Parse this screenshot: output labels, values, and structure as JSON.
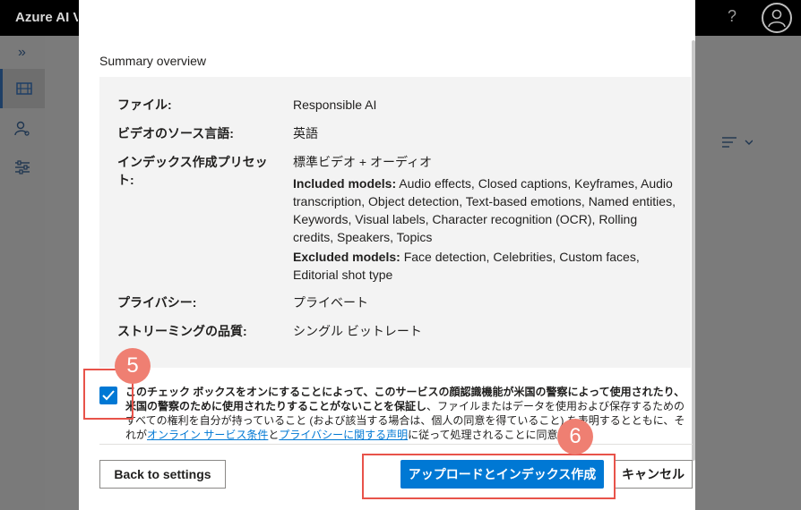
{
  "app": {
    "title": "Azure AI Video Indexer",
    "help_glyph": "?",
    "expand_glyph": "»",
    "sidebar_icons": [
      "media-icon",
      "people-icon",
      "settings-sliders-icon"
    ]
  },
  "dialog": {
    "summary_title": "Summary overview",
    "rows": {
      "file_label": "ファイル:",
      "file_value": "Responsible AI",
      "lang_label": "ビデオのソース言語:",
      "lang_value": "英語",
      "preset_label_1": "インデックス作成プリセッ",
      "preset_label_2": "ト:",
      "preset_value": "標準ビデオ + オーディオ",
      "included_label": "Included models:",
      "included_value": " Audio effects, Closed captions, Keyframes, Audio transcription, Object detection, Text-based emotions, Named entities, Keywords, Visual labels, Character recognition (OCR), Rolling credits, Speakers, Topics",
      "excluded_label": "Excluded models:",
      "excluded_value": " Face detection, Celebrities, Custom faces, Editorial shot type",
      "privacy_label": "プライバシー:",
      "privacy_value": "プライベート",
      "streaming_label": "ストリーミングの品質:",
      "streaming_value": "シングル ビットレート"
    },
    "consent": {
      "checked": true,
      "bold_text": "このチェック ボックスをオンにすることによって、このサービスの顔認識機能が米国の警察によって使用されたり、米国の警察のために使用されたりすることがないことを保証し",
      "text_1": "、ファイルまたはデータを使用および保存するためのすべての権利を自分が持っていること (および該当する場合は、個人の同意を得ていること) を表明するとともに、それが",
      "link_1": "オンライン サービス条件",
      "text_2": "と",
      "link_2": "プライバシーに関する声明",
      "text_3": "に従って処理されることに同意します。"
    },
    "buttons": {
      "back": "Back to settings",
      "upload": "アップロードとインデックス作成",
      "cancel": "キャンセル"
    }
  },
  "annotations": {
    "step5": "5",
    "step6": "6",
    "color": "#e8534a"
  }
}
